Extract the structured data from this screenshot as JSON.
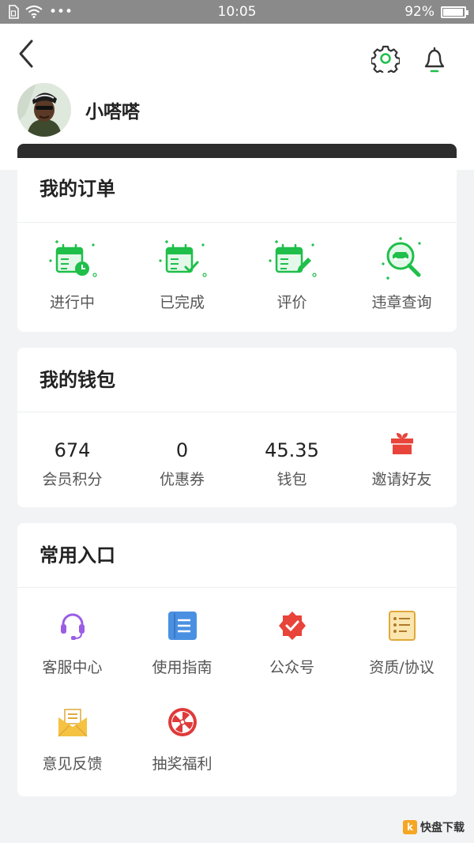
{
  "status_bar": {
    "time": "10:05",
    "battery": "92%",
    "dots": "•••"
  },
  "user": {
    "name": "小嗒嗒"
  },
  "orders": {
    "title": "我的订单",
    "items": [
      {
        "label": "进行中",
        "icon": "calendar-clock-icon"
      },
      {
        "label": "已完成",
        "icon": "calendar-check-icon"
      },
      {
        "label": "评价",
        "icon": "calendar-edit-icon"
      },
      {
        "label": "违章查询",
        "icon": "car-search-icon"
      }
    ]
  },
  "wallet": {
    "title": "我的钱包",
    "items": [
      {
        "value": "674",
        "label": "会员积分"
      },
      {
        "value": "0",
        "label": "优惠券"
      },
      {
        "value": "45.35",
        "label": "钱包"
      },
      {
        "label": "邀请好友",
        "icon": "gift-icon"
      }
    ]
  },
  "entries": {
    "title": "常用入口",
    "items": [
      {
        "label": "客服中心",
        "icon": "headset-icon"
      },
      {
        "label": "使用指南",
        "icon": "notebook-icon"
      },
      {
        "label": "公众号",
        "icon": "badge-check-icon"
      },
      {
        "label": "资质/协议",
        "icon": "document-list-icon"
      },
      {
        "label": "意见反馈",
        "icon": "envelope-icon"
      },
      {
        "label": "抽奖福利",
        "icon": "lottery-wheel-icon"
      }
    ]
  },
  "watermark": {
    "logo": "k",
    "text": "快盘下载"
  },
  "colors": {
    "accent_green": "#1fbf4a",
    "header_bg": "#ffffff",
    "page_bg": "#f2f3f5",
    "status_bar": "#8a8a8a"
  }
}
